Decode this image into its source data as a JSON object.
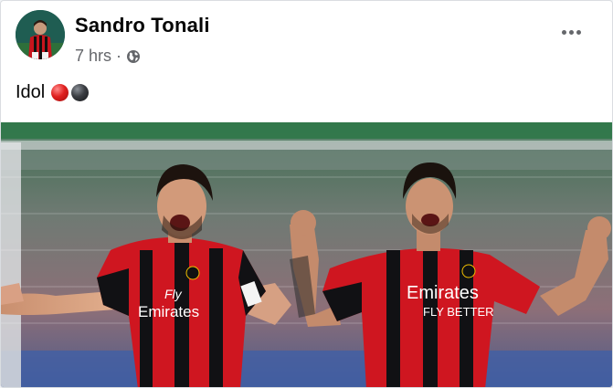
{
  "post": {
    "author": "Sandro Tonali",
    "time": "7 hrs",
    "separator": "·",
    "privacy_icon": "globe-icon",
    "more_icon": "more-options-icon",
    "caption": "Idol",
    "caption_emojis": [
      "red-circle-emoji",
      "black-circle-emoji"
    ],
    "photo": {
      "left_jersey_sponsor_top": "Fly",
      "left_jersey_sponsor": "Emirates",
      "right_jersey_sponsor": "Emirates",
      "right_jersey_sponsor_sub": "FLY BETTER"
    }
  },
  "colors": {
    "author_text": "#050505",
    "meta_text": "#65676b",
    "milan_red": "#d0141e",
    "milan_black": "#0d0d0f"
  }
}
